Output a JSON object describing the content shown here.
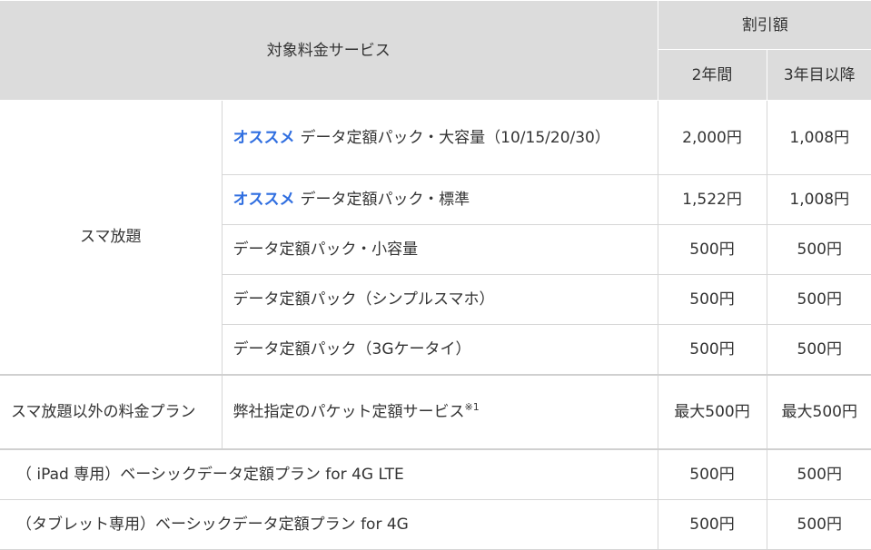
{
  "header": {
    "target_service": "対象料金サービス",
    "discount": "割引額",
    "year2": "2年間",
    "year3": "3年目以降"
  },
  "sumahodai": {
    "label": "スマ放題",
    "rows": [
      {
        "badge": "オススメ",
        "service": "データ定額パック・大容量（10/15/20/30）",
        "y2": "2,000円",
        "y3": "1,008円"
      },
      {
        "badge": "オススメ",
        "service": "データ定額パック・標準",
        "y2": "1,522円",
        "y3": "1,008円"
      },
      {
        "service": "データ定額パック・小容量",
        "y2": "500円",
        "y3": "500円"
      },
      {
        "service": "データ定額パック（シンプルスマホ）",
        "y2": "500円",
        "y3": "500円"
      },
      {
        "service": "データ定額パック（3Gケータイ）",
        "y2": "500円",
        "y3": "500円"
      }
    ]
  },
  "other": {
    "label": "スマ放題以外の料金プラン",
    "service": "弊社指定のパケット定額サービス",
    "note": "※1",
    "y2": "最大500円",
    "y3": "最大500円"
  },
  "ipad": {
    "service": "（ iPad 専用）ベーシックデータ定額プラン for 4G LTE",
    "y2": "500円",
    "y3": "500円"
  },
  "tablet": {
    "service": "（タブレット専用）ベーシックデータ定額プラン for 4G",
    "y2": "500円",
    "y3": "500円"
  }
}
